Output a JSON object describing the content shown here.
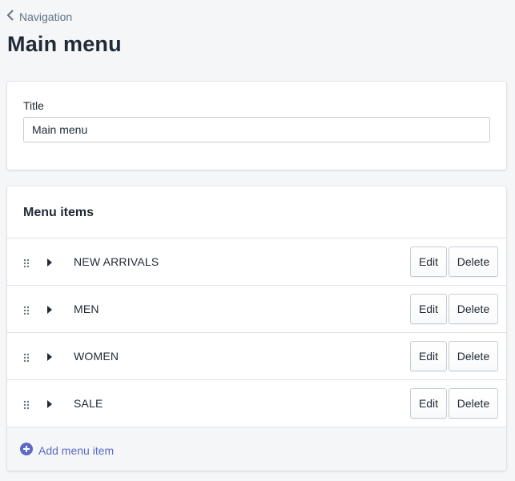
{
  "breadcrumb": {
    "label": "Navigation"
  },
  "page": {
    "title": "Main menu"
  },
  "title_card": {
    "label": "Title",
    "value": "Main menu"
  },
  "menu_card": {
    "heading": "Menu items",
    "items": [
      {
        "label": "NEW ARRIVALS",
        "edit": "Edit",
        "delete": "Delete"
      },
      {
        "label": "MEN",
        "edit": "Edit",
        "delete": "Delete"
      },
      {
        "label": "WOMEN",
        "edit": "Edit",
        "delete": "Delete"
      },
      {
        "label": "SALE",
        "edit": "Edit",
        "delete": "Delete"
      }
    ],
    "add_label": "Add menu item"
  },
  "icons": {
    "back": "chevron-left-icon",
    "drag": "drag-handle-icon",
    "expand": "caret-right-icon",
    "add": "plus-circle-icon"
  },
  "colors": {
    "background": "#f4f6f8",
    "accent": "#5c6ac4",
    "text": "#212b36",
    "muted": "#637381"
  }
}
